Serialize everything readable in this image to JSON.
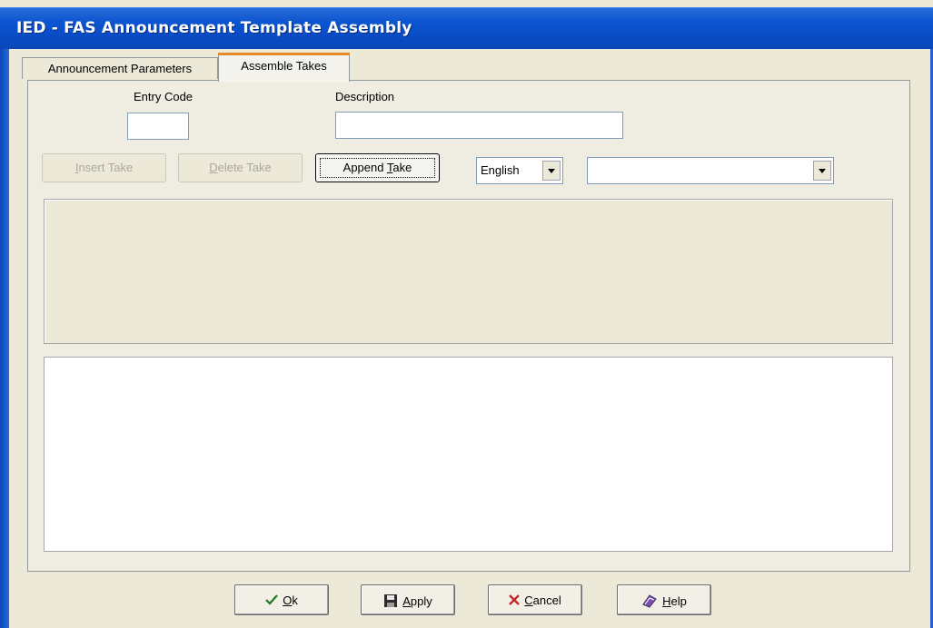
{
  "window": {
    "title": "IED - FAS Announcement Template Assembly"
  },
  "tabs": [
    {
      "label": "Announcement Parameters",
      "active": false
    },
    {
      "label": "Assemble Takes",
      "active": true
    }
  ],
  "form": {
    "entry_code": {
      "label": "Entry Code",
      "value": ""
    },
    "description": {
      "label": "Description",
      "value": ""
    }
  },
  "toolbar": {
    "insert_take": {
      "pre": "",
      "mnemonic": "I",
      "post": "nsert Take",
      "enabled": false
    },
    "delete_take": {
      "pre": "",
      "mnemonic": "D",
      "post": "elete Take",
      "enabled": false
    },
    "append_take": {
      "pre": "Append ",
      "mnemonic": "T",
      "post": "ake",
      "enabled": true
    },
    "language": {
      "value": "English"
    },
    "take_select": {
      "value": ""
    }
  },
  "footer": {
    "ok": {
      "pre": "",
      "mnemonic": "O",
      "post": "k",
      "icon": "check-icon"
    },
    "apply": {
      "pre": "",
      "mnemonic": "A",
      "post": "pply",
      "icon": "floppy-disk-icon"
    },
    "cancel": {
      "pre": "",
      "mnemonic": "C",
      "post": "ancel",
      "icon": "x-icon"
    },
    "help": {
      "pre": "",
      "mnemonic": "H",
      "post": "elp",
      "icon": "help-book-icon"
    }
  },
  "colors": {
    "titlebar": "#0a54d0",
    "face": "#ece9d8",
    "tab_highlight": "#e68b2c",
    "cancel_x": "#c0282a",
    "ok_check": "#1f7a1f"
  }
}
